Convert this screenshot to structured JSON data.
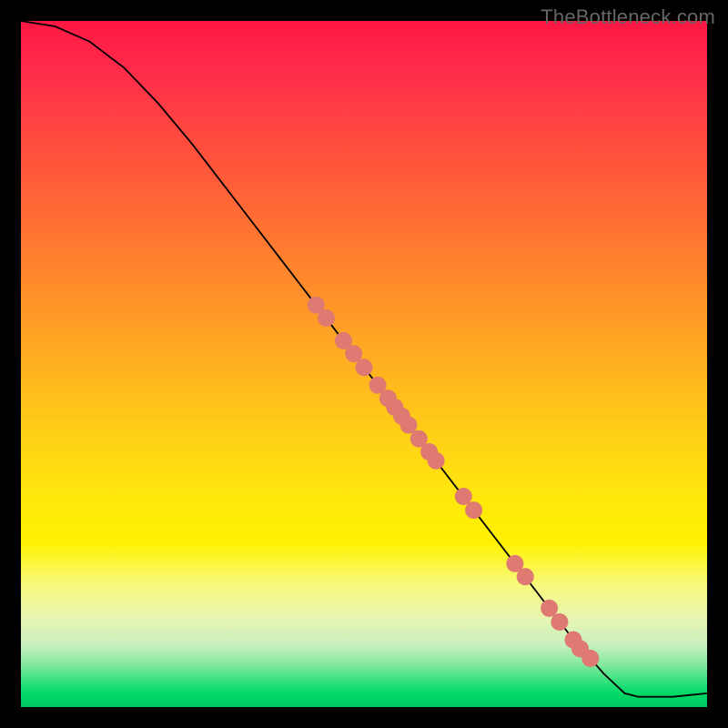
{
  "attribution": "TheBottleneck.com",
  "colors": {
    "gradient_top": "#ff1744",
    "gradient_bottom": "#00c760",
    "marker": "#de7a71",
    "line": "#000000",
    "frame": "#000000"
  },
  "chart_data": {
    "type": "line",
    "title": "",
    "xlabel": "",
    "ylabel": "",
    "xlim": [
      0,
      1
    ],
    "ylim": [
      0,
      1
    ],
    "grid": false,
    "legend": false,
    "series": [
      {
        "name": "curve",
        "x": [
          0.0,
          0.05,
          0.1,
          0.15,
          0.2,
          0.25,
          0.3,
          0.35,
          0.4,
          0.45,
          0.5,
          0.55,
          0.6,
          0.65,
          0.7,
          0.75,
          0.8,
          0.85,
          0.88,
          0.9,
          0.95,
          1.0
        ],
        "y": [
          1.0,
          0.992,
          0.97,
          0.932,
          0.88,
          0.82,
          0.755,
          0.69,
          0.625,
          0.56,
          0.495,
          0.43,
          0.365,
          0.3,
          0.235,
          0.17,
          0.105,
          0.048,
          0.02,
          0.015,
          0.015,
          0.02
        ]
      }
    ],
    "markers": {
      "name": "points-on-curve",
      "x": [
        0.43,
        0.445,
        0.47,
        0.485,
        0.5,
        0.52,
        0.535,
        0.545,
        0.555,
        0.565,
        0.58,
        0.595,
        0.605,
        0.645,
        0.66,
        0.72,
        0.735,
        0.77,
        0.785,
        0.805,
        0.815,
        0.83
      ],
      "y": [
        0.586,
        0.567,
        0.534,
        0.515,
        0.495,
        0.469,
        0.45,
        0.437,
        0.424,
        0.411,
        0.391,
        0.372,
        0.359,
        0.307,
        0.287,
        0.209,
        0.19,
        0.144,
        0.124,
        0.098,
        0.085,
        0.071
      ]
    }
  }
}
